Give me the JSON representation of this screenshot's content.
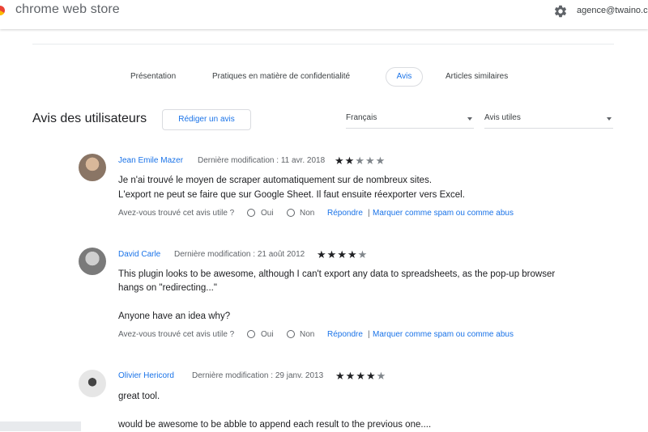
{
  "header": {
    "brand": "chrome web store",
    "account": "agence@twaino.co"
  },
  "tabs": [
    {
      "label": "Présentation"
    },
    {
      "label": "Pratiques en matière de confidentialité"
    },
    {
      "label": "Avis",
      "active": true
    },
    {
      "label": "Articles similaires"
    }
  ],
  "section": {
    "title": "Avis des utilisateurs",
    "write_review": "Rédiger un avis",
    "language_select": "Français",
    "sort_select": "Avis utiles"
  },
  "helpful_prompt": "Avez-vous trouvé cet avis utile ?",
  "yes_label": "Oui",
  "no_label": "Non",
  "reply_label": "Répondre",
  "separator": "|",
  "spam_label": "Marquer comme spam ou comme abus",
  "reviews": [
    {
      "author": "Jean Emile Mazer",
      "date": "Dernière modification : 11 avr. 2018",
      "rating": 2,
      "lines": [
        "Je n'ai trouvé le moyen de scraper automatiquement sur de nombreux sites.",
        "L'export ne peut se faire que sur Google Sheet. Il faut ensuite réexporter vers Excel."
      ]
    },
    {
      "author": "David Carle",
      "date": "Dernière modification : 21 août 2012",
      "rating": 4,
      "lines": [
        "This plugin looks to be awesome, although I can't export any data to spreadsheets, as the pop-up browser",
        "hangs on \"redirecting...\"",
        "",
        "Anyone have an idea why?"
      ]
    },
    {
      "author": "Olivier Hericord",
      "date": "Dernière modification : 29 janv. 2013",
      "rating": 4,
      "lines": [
        "great tool.",
        "",
        "would be awesome to be abble to append each result to the previous one...."
      ]
    }
  ],
  "colors": {
    "link": "#1a73e8",
    "star_on": "#202124",
    "star_off": "#80868b"
  }
}
